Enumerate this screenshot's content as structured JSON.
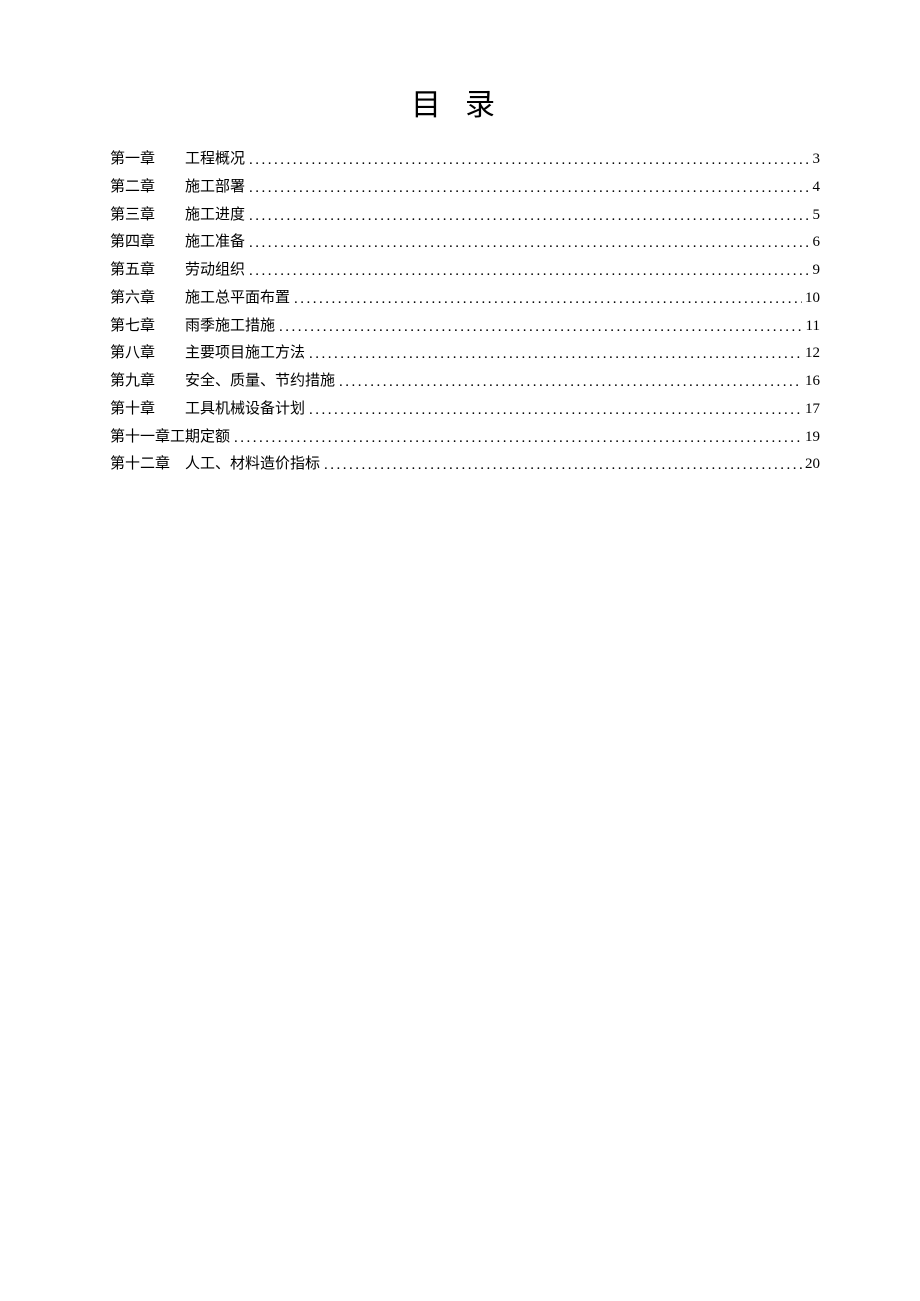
{
  "title": "目录",
  "toc": [
    {
      "chapter": "第一章",
      "gap": "　　",
      "name": "工程概况",
      "page": "3",
      "indent": true
    },
    {
      "chapter": "第二章",
      "gap": "　　",
      "name": "施工部署",
      "page": "4",
      "indent": true
    },
    {
      "chapter": "第三章",
      "gap": "　　",
      "name": "施工进度",
      "page": "5",
      "indent": true
    },
    {
      "chapter": "第四章",
      "gap": "　　",
      "name": "施工准备",
      "page": "6",
      "indent": true
    },
    {
      "chapter": "第五章",
      "gap": "　　",
      "name": "劳动组织",
      "page": "9",
      "indent": true
    },
    {
      "chapter": "第六章",
      "gap": "　　",
      "name": "施工总平面布置",
      "page": "10",
      "indent": true
    },
    {
      "chapter": "第七章",
      "gap": "　　",
      "name": "雨季施工措施",
      "page": "11",
      "indent": true
    },
    {
      "chapter": "第八章",
      "gap": "　　",
      "name": "主要项目施工方法",
      "page": "12",
      "indent": true
    },
    {
      "chapter": "第九章",
      "gap": "　　",
      "name": "安全、质量、节约措施",
      "page": "16",
      "indent": true
    },
    {
      "chapter": "第十章",
      "gap": "　　",
      "name": "工具机械设备计划",
      "page": "17",
      "indent": true
    },
    {
      "chapter": "第十一章",
      "gap": "",
      "name": "工期定额",
      "page": "19",
      "indent": false
    },
    {
      "chapter": "第十二章",
      "gap": "　",
      "name": "人工、材料造价指标",
      "page": "20",
      "indent": false
    }
  ]
}
